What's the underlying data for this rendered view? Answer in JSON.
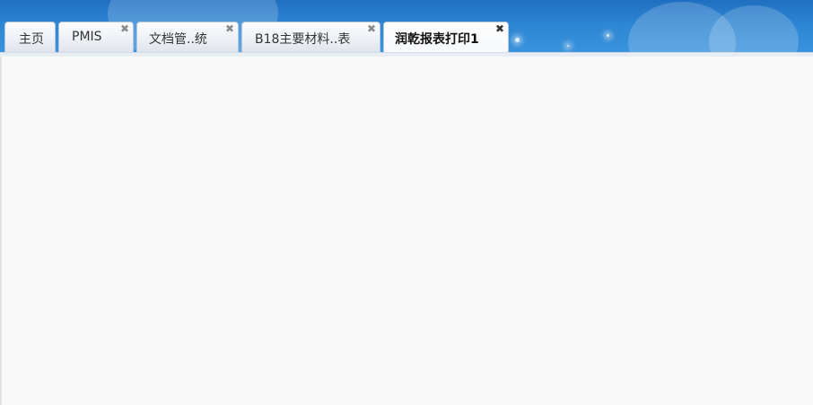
{
  "tabs": [
    {
      "label": "主页",
      "closable": false,
      "active": false
    },
    {
      "label": "PMIS",
      "closable": true,
      "active": false
    },
    {
      "label": "文档管..统",
      "closable": true,
      "active": false
    },
    {
      "label": "B18主要材料..表",
      "closable": true,
      "active": false
    },
    {
      "label": "润乾报表打印1",
      "closable": true,
      "active": true
    }
  ],
  "close_symbol": "✖",
  "colors": {
    "header_blue": "#2d85d3",
    "tab_border": "#b7c7db",
    "content_bg": "#f9f9f9"
  }
}
